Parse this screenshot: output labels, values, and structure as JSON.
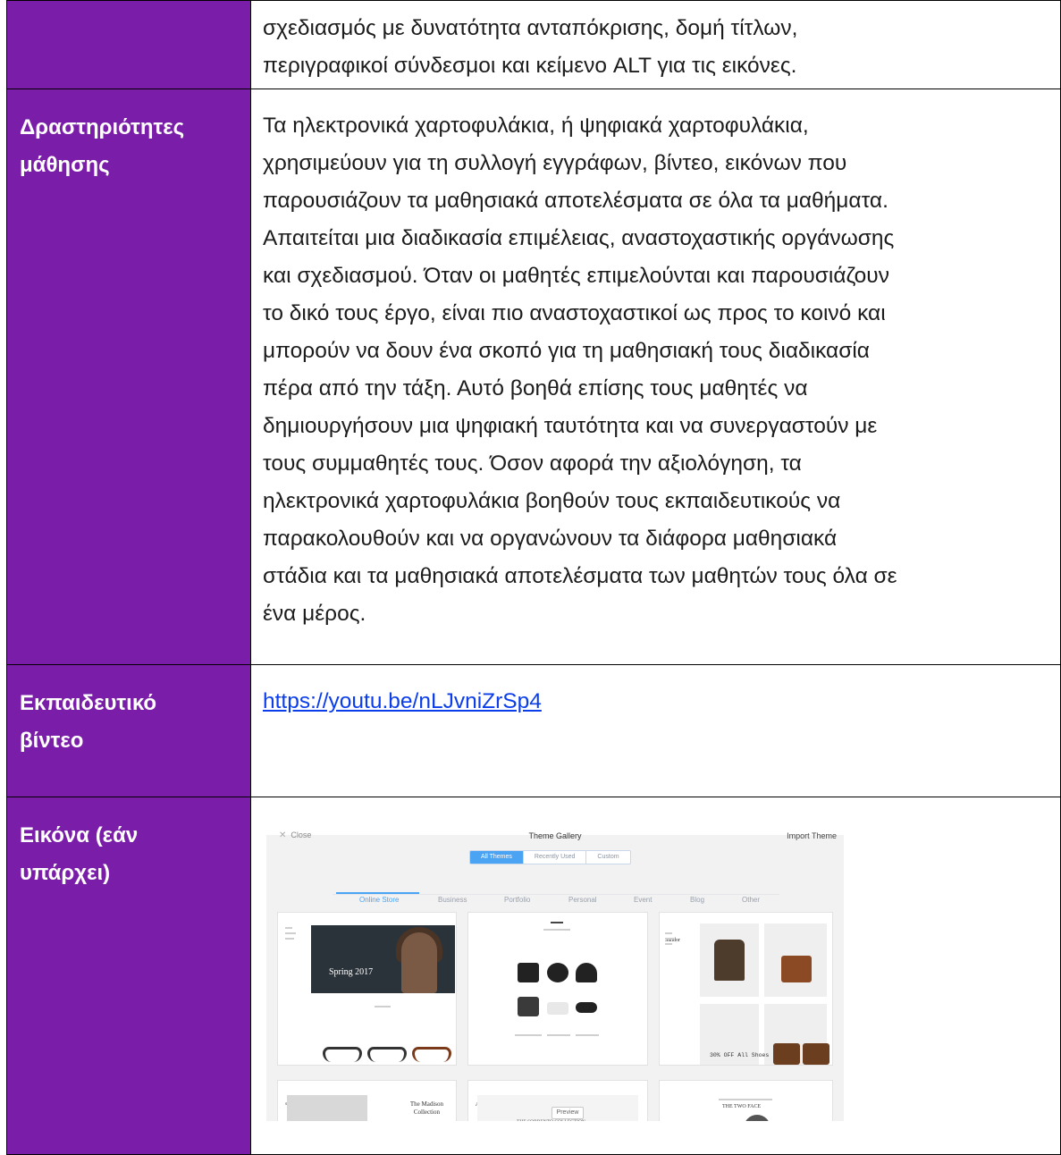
{
  "rows": [
    {
      "label": "",
      "lines": [
        "σχεδιασμός με δυνατότητα ανταπόκρισης, δομή τίτλων,",
        "περιγραφικοί σύνδεσμοι και κείμενο ALT για τις εικόνες."
      ]
    },
    {
      "label_lines": [
        "Δραστηριότητες",
        "μάθησης"
      ],
      "lines": [
        "Τα ηλεκτρονικά χαρτοφυλάκια, ή ψηφιακά χαρτοφυλάκια,",
        "χρησιμεύουν για τη συλλογή εγγράφων, βίντεο, εικόνων που",
        "παρουσιάζουν τα μαθησιακά αποτελέσματα σε όλα τα μαθήματα.",
        "Απαιτείται μια διαδικασία επιμέλειας, αναστοχαστικής οργάνωσης",
        "και σχεδιασμού. Όταν οι μαθητές επιμελούνται και παρουσιάζουν",
        "το δικό τους έργο, είναι πιο αναστοχαστικοί ως προς το κοινό και",
        "μπορούν να δουν ένα σκοπό για τη μαθησιακή τους διαδικασία",
        "πέρα από την τάξη. Αυτό βοηθά επίσης τους μαθητές να",
        "δημιουργήσουν μια ψηφιακή ταυτότητα και να συνεργαστούν με",
        "τους συμμαθητές τους.  Όσον αφορά την αξιολόγηση, τα",
        "ηλεκτρονικά χαρτοφυλάκια βοηθούν τους εκπαιδευτικούς να",
        "παρακολουθούν και να οργανώνουν τα διάφορα μαθησιακά",
        "στάδια και τα μαθησιακά αποτελέσματα των μαθητών τους όλα σε",
        "ένα μέρος."
      ]
    },
    {
      "label_lines": [
        "Εκπαιδευτικό",
        "βίντεο"
      ],
      "link": "https://youtu.be/nLJvniZrSp4"
    },
    {
      "label_lines": [
        "Εικόνα (εάν",
        "υπάρχει)"
      ]
    }
  ],
  "screenshot": {
    "close": "Close",
    "title": "Theme Gallery",
    "import": "Import Theme",
    "segments": [
      "All Themes",
      "Recently Used",
      "Custom"
    ],
    "categories": [
      "Online Store",
      "Business",
      "Portfolio",
      "Personal",
      "Event",
      "Blog",
      "Other"
    ],
    "card1_hero": "Spring 2017",
    "card3_sale": "30% OFF All Shoes",
    "card4_title": [
      "The Madison",
      "Collection"
    ],
    "card5_brand": "AVENUE",
    "card5_collection": "THE SORRENTO COLLECTION",
    "card5_preview": "Preview",
    "card6_brand": "THE TWO FACE",
    "card3_brand": "Sandor",
    "card4_brand": "STORYLE"
  }
}
